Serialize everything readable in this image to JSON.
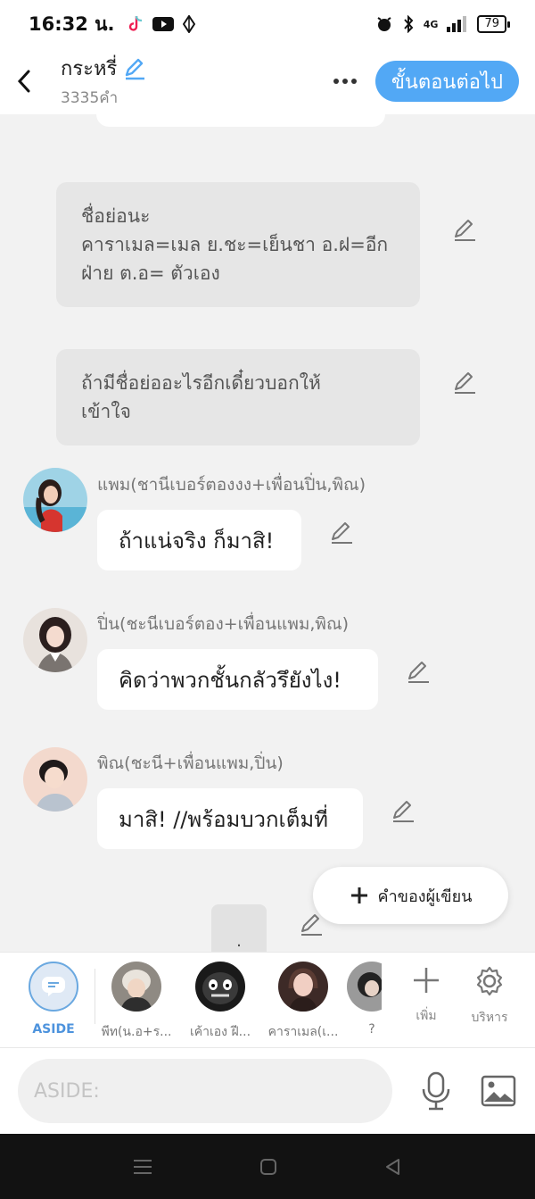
{
  "status_bar": {
    "time": "16:32 น.",
    "battery": "79",
    "network": "4G"
  },
  "header": {
    "title": "กระหรี่",
    "word_count": "3335คำ",
    "next_button": "ขั้นตอนต่อไป"
  },
  "narrations": [
    {
      "lines": [
        "ชื่อย่อนะ",
        "คาราเมล=เมล  ย.ชะ=เย็นชา  อ.ฝ=อีก",
        "ฝ่าย  ต.อ= ตัวเอง"
      ]
    },
    {
      "lines": [
        "ถ้ามีชื่อย่ออะไรอีกเดี๋ยวบอกให้",
        "เข้าใจ"
      ]
    }
  ],
  "messages": [
    {
      "name": "แพม(ชานีเบอร์ตองงง+เพื่อนปิ่น,พิณ)",
      "text": "ถ้าแน่จริง ก็มาสิ!"
    },
    {
      "name": "ปิ่น(ชะนีเบอร์ตอง+เพื่อนแพม,พิณ)",
      "text": "คิดว่าพวกชั้นกลัวรึยังไง!"
    },
    {
      "name": "พิณ(ชะนี+เพื่อนแพม,ปิ่น)",
      "text": "มาสิ! //พร้อมบวกเต็มที่"
    }
  ],
  "writer_button": "คำของผู้เขียน",
  "typing_indicator": ".",
  "character_bar": {
    "aside_label": "ASIDE",
    "characters": [
      {
        "label": "พีท(น.อ+ร..."
      },
      {
        "label": "เค้าเอง ฝี..."
      },
      {
        "label": "คาราเมล(เ..."
      },
      {
        "label": "?"
      }
    ],
    "add_label": "เพิ่ม",
    "manage_label": "บริหาร"
  },
  "input": {
    "placeholder": "ASIDE:"
  },
  "colors": {
    "accent": "#52a8f5",
    "background": "#f2f2f2",
    "bubble": "#ffffff",
    "narration": "#e6e6e6"
  }
}
